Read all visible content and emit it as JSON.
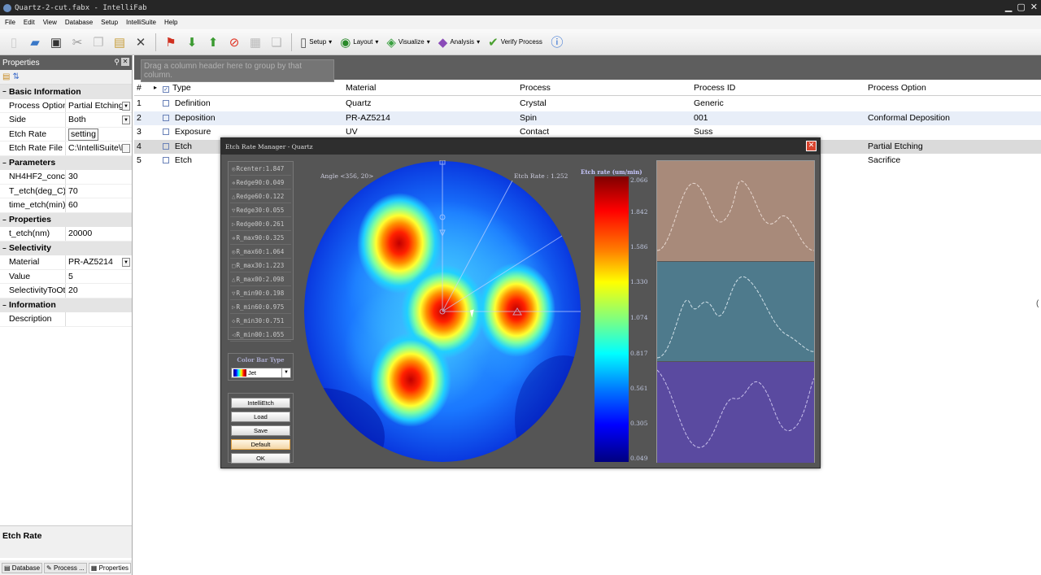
{
  "window": {
    "title": "Quartz-2-cut.fabx - IntelliFab"
  },
  "menu": [
    "File",
    "Edit",
    "View",
    "Database",
    "Setup",
    "IntelliSuite",
    "Help"
  ],
  "toolbar": {
    "setup": "Setup",
    "layout": "Layout",
    "visualize": "Visualize",
    "analysis": "Analysis",
    "verify": "Verify Process"
  },
  "properties": {
    "title": "Properties",
    "categories": [
      {
        "name": "Basic Information",
        "rows": [
          {
            "key": "Process Option",
            "value": "Partial Etching"
          },
          {
            "key": "Side",
            "value": "Both"
          },
          {
            "key": "Etch Rate",
            "value": "setting"
          },
          {
            "key": "Etch Rate File",
            "value": "C:\\IntelliSuite\\N"
          }
        ]
      },
      {
        "name": "Parameters",
        "rows": [
          {
            "key": "NH4HF2_conc(%",
            "value": "30"
          },
          {
            "key": "T_etch(deg_C)",
            "value": "70"
          },
          {
            "key": "time_etch(min)",
            "value": "60"
          }
        ]
      },
      {
        "name": "Properties",
        "rows": [
          {
            "key": "t_etch(nm)",
            "value": "20000"
          }
        ]
      },
      {
        "name": "Selectivity",
        "rows": [
          {
            "key": "Material",
            "value": "PR-AZ5214"
          },
          {
            "key": "Value",
            "value": "5"
          },
          {
            "key": "SelectivityToOth",
            "value": "20"
          }
        ]
      },
      {
        "name": "Information",
        "rows": [
          {
            "key": "Description",
            "value": ""
          }
        ]
      }
    ],
    "description_title": "Etch Rate",
    "bottom_tabs": [
      "Database",
      "Process ...",
      "Properties"
    ]
  },
  "grid": {
    "group_hint": "Drag a column header here to group by that column.",
    "columns": [
      "#",
      "Type",
      "Material",
      "Process",
      "Process ID",
      "Process Option"
    ],
    "rows": [
      {
        "num": "1",
        "type": "Definition",
        "material": "Quartz",
        "process": "Crystal",
        "pid": "Generic",
        "option": ""
      },
      {
        "num": "2",
        "type": "Deposition",
        "material": "PR-AZ5214",
        "process": "Spin",
        "pid": "001",
        "option": "Conformal Deposition"
      },
      {
        "num": "3",
        "type": "Exposure",
        "material": "UV",
        "process": "Contact",
        "pid": "Suss",
        "option": ""
      },
      {
        "num": "4",
        "type": "Etch",
        "material": "",
        "process": "",
        "pid": "",
        "option": "Partial Etching"
      },
      {
        "num": "5",
        "type": "Etch",
        "material": "",
        "process": "",
        "pid": "",
        "option": "Sacrifice"
      }
    ]
  },
  "dialog": {
    "title": "Etch Rate Manager - Quartz",
    "params": [
      "Rcenter:1.847",
      "Redge90:0.049",
      "Redge60:0.122",
      "Redge30:0.055",
      "Redge00:0.261",
      "R_max90:0.325",
      "R_max60:1.064",
      "R_max30:1.223",
      "R_max00:2.098",
      "R_min90:0.198",
      "R_min60:0.975",
      "R_min30:0.751",
      "R_min00:1.055"
    ],
    "color_bar_type_label": "Color Bar Type",
    "color_bar_type": "Jet",
    "buttons": [
      "IntelliEtch",
      "Load",
      "Save",
      "Default",
      "OK"
    ],
    "angle_text": "Angle <356, 20>",
    "etch_rate_text": "Etch Rate : 1.252",
    "colorbar_title": "Etch rate (um/min)",
    "colorbar_ticks": [
      "2.066",
      "1.842",
      "1.586",
      "1.330",
      "1.074",
      "0.817",
      "0.561",
      "0.305",
      "0.049"
    ],
    "colors": {
      "panel1": "#a88a7a",
      "panel2": "#4e7a8c",
      "panel3": "#5a4aa0"
    }
  }
}
